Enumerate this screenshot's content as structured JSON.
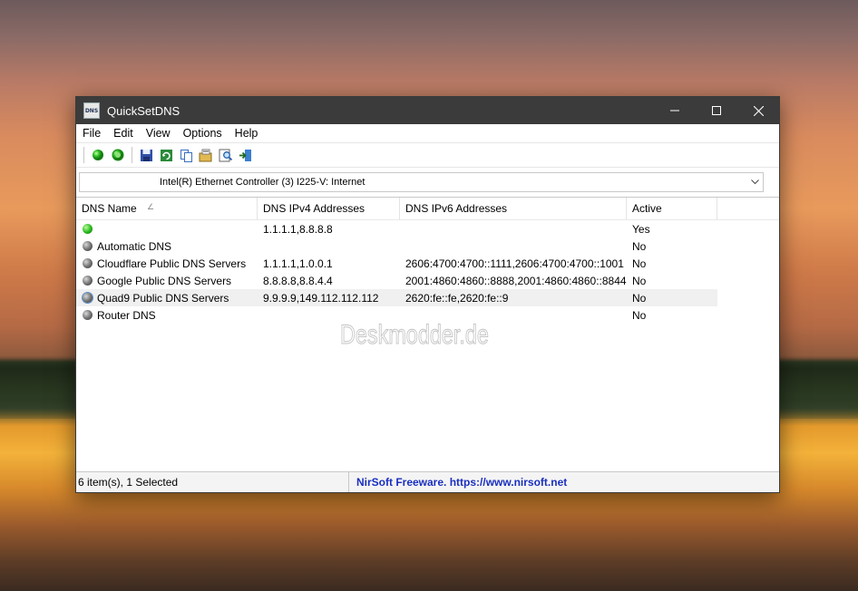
{
  "window": {
    "title": "QuickSetDNS",
    "icon_label": "DNS"
  },
  "menu": [
    "File",
    "Edit",
    "View",
    "Options",
    "Help"
  ],
  "toolbar": {
    "icons": [
      "green-dot-icon",
      "green-globe-icon",
      "save-icon",
      "refresh-icon",
      "copy-icon",
      "properties-icon",
      "find-icon",
      "exit-icon"
    ]
  },
  "adapter": {
    "selected": "Intel(R) Ethernet Controller (3) I225-V: Internet"
  },
  "columns": [
    "DNS Name",
    "DNS IPv4 Addresses",
    "DNS IPv6 Addresses",
    "Active"
  ],
  "rows": [
    {
      "name": "",
      "ipv4": "1.1.1.1,8.8.8.8",
      "ipv6": "",
      "active": "Yes",
      "status": "green",
      "selected": false
    },
    {
      "name": "Automatic DNS",
      "ipv4": "",
      "ipv6": "",
      "active": "No",
      "status": "gray",
      "selected": false
    },
    {
      "name": "Cloudflare Public DNS Servers",
      "ipv4": "1.1.1.1,1.0.0.1",
      "ipv6": "2606:4700:4700::1111,2606:4700:4700::1001",
      "active": "No",
      "status": "gray",
      "selected": false
    },
    {
      "name": "Google Public DNS Servers",
      "ipv4": "8.8.8.8,8.8.4.4",
      "ipv6": "2001:4860:4860::8888,2001:4860:4860::8844",
      "active": "No",
      "status": "gray",
      "selected": false
    },
    {
      "name": "Quad9 Public DNS Servers",
      "ipv4": "9.9.9.9,149.112.112.112",
      "ipv6": "2620:fe::fe,2620:fe::9",
      "active": "No",
      "status": "gray",
      "selected": true
    },
    {
      "name": "Router DNS",
      "ipv4": "",
      "ipv6": "",
      "active": "No",
      "status": "gray",
      "selected": false
    }
  ],
  "watermark": "Deskmodder.de",
  "status": {
    "count": "6 item(s), 1 Selected",
    "credit": "NirSoft Freeware. https://www.nirsoft.net"
  },
  "colors": {
    "titlebar": "#3b3b3b",
    "credit_link": "#1a2fc0",
    "active_green": "#27b51e"
  }
}
